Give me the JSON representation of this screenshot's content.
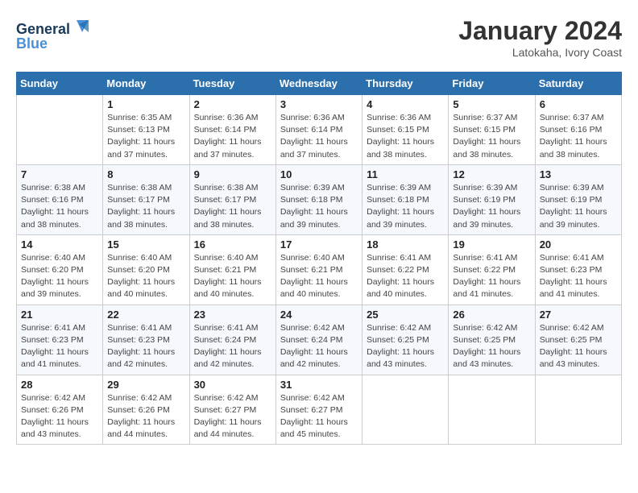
{
  "header": {
    "logo_line1": "General",
    "logo_line2": "Blue",
    "month_year": "January 2024",
    "location": "Latokaha, Ivory Coast"
  },
  "weekdays": [
    "Sunday",
    "Monday",
    "Tuesday",
    "Wednesday",
    "Thursday",
    "Friday",
    "Saturday"
  ],
  "weeks": [
    [
      {
        "day": "",
        "sunrise": "",
        "sunset": "",
        "daylight": ""
      },
      {
        "day": "1",
        "sunrise": "Sunrise: 6:35 AM",
        "sunset": "Sunset: 6:13 PM",
        "daylight": "Daylight: 11 hours and 37 minutes."
      },
      {
        "day": "2",
        "sunrise": "Sunrise: 6:36 AM",
        "sunset": "Sunset: 6:14 PM",
        "daylight": "Daylight: 11 hours and 37 minutes."
      },
      {
        "day": "3",
        "sunrise": "Sunrise: 6:36 AM",
        "sunset": "Sunset: 6:14 PM",
        "daylight": "Daylight: 11 hours and 37 minutes."
      },
      {
        "day": "4",
        "sunrise": "Sunrise: 6:36 AM",
        "sunset": "Sunset: 6:15 PM",
        "daylight": "Daylight: 11 hours and 38 minutes."
      },
      {
        "day": "5",
        "sunrise": "Sunrise: 6:37 AM",
        "sunset": "Sunset: 6:15 PM",
        "daylight": "Daylight: 11 hours and 38 minutes."
      },
      {
        "day": "6",
        "sunrise": "Sunrise: 6:37 AM",
        "sunset": "Sunset: 6:16 PM",
        "daylight": "Daylight: 11 hours and 38 minutes."
      }
    ],
    [
      {
        "day": "7",
        "sunrise": "Sunrise: 6:38 AM",
        "sunset": "Sunset: 6:16 PM",
        "daylight": "Daylight: 11 hours and 38 minutes."
      },
      {
        "day": "8",
        "sunrise": "Sunrise: 6:38 AM",
        "sunset": "Sunset: 6:17 PM",
        "daylight": "Daylight: 11 hours and 38 minutes."
      },
      {
        "day": "9",
        "sunrise": "Sunrise: 6:38 AM",
        "sunset": "Sunset: 6:17 PM",
        "daylight": "Daylight: 11 hours and 38 minutes."
      },
      {
        "day": "10",
        "sunrise": "Sunrise: 6:39 AM",
        "sunset": "Sunset: 6:18 PM",
        "daylight": "Daylight: 11 hours and 39 minutes."
      },
      {
        "day": "11",
        "sunrise": "Sunrise: 6:39 AM",
        "sunset": "Sunset: 6:18 PM",
        "daylight": "Daylight: 11 hours and 39 minutes."
      },
      {
        "day": "12",
        "sunrise": "Sunrise: 6:39 AM",
        "sunset": "Sunset: 6:19 PM",
        "daylight": "Daylight: 11 hours and 39 minutes."
      },
      {
        "day": "13",
        "sunrise": "Sunrise: 6:39 AM",
        "sunset": "Sunset: 6:19 PM",
        "daylight": "Daylight: 11 hours and 39 minutes."
      }
    ],
    [
      {
        "day": "14",
        "sunrise": "Sunrise: 6:40 AM",
        "sunset": "Sunset: 6:20 PM",
        "daylight": "Daylight: 11 hours and 39 minutes."
      },
      {
        "day": "15",
        "sunrise": "Sunrise: 6:40 AM",
        "sunset": "Sunset: 6:20 PM",
        "daylight": "Daylight: 11 hours and 40 minutes."
      },
      {
        "day": "16",
        "sunrise": "Sunrise: 6:40 AM",
        "sunset": "Sunset: 6:21 PM",
        "daylight": "Daylight: 11 hours and 40 minutes."
      },
      {
        "day": "17",
        "sunrise": "Sunrise: 6:40 AM",
        "sunset": "Sunset: 6:21 PM",
        "daylight": "Daylight: 11 hours and 40 minutes."
      },
      {
        "day": "18",
        "sunrise": "Sunrise: 6:41 AM",
        "sunset": "Sunset: 6:22 PM",
        "daylight": "Daylight: 11 hours and 40 minutes."
      },
      {
        "day": "19",
        "sunrise": "Sunrise: 6:41 AM",
        "sunset": "Sunset: 6:22 PM",
        "daylight": "Daylight: 11 hours and 41 minutes."
      },
      {
        "day": "20",
        "sunrise": "Sunrise: 6:41 AM",
        "sunset": "Sunset: 6:23 PM",
        "daylight": "Daylight: 11 hours and 41 minutes."
      }
    ],
    [
      {
        "day": "21",
        "sunrise": "Sunrise: 6:41 AM",
        "sunset": "Sunset: 6:23 PM",
        "daylight": "Daylight: 11 hours and 41 minutes."
      },
      {
        "day": "22",
        "sunrise": "Sunrise: 6:41 AM",
        "sunset": "Sunset: 6:23 PM",
        "daylight": "Daylight: 11 hours and 42 minutes."
      },
      {
        "day": "23",
        "sunrise": "Sunrise: 6:41 AM",
        "sunset": "Sunset: 6:24 PM",
        "daylight": "Daylight: 11 hours and 42 minutes."
      },
      {
        "day": "24",
        "sunrise": "Sunrise: 6:42 AM",
        "sunset": "Sunset: 6:24 PM",
        "daylight": "Daylight: 11 hours and 42 minutes."
      },
      {
        "day": "25",
        "sunrise": "Sunrise: 6:42 AM",
        "sunset": "Sunset: 6:25 PM",
        "daylight": "Daylight: 11 hours and 43 minutes."
      },
      {
        "day": "26",
        "sunrise": "Sunrise: 6:42 AM",
        "sunset": "Sunset: 6:25 PM",
        "daylight": "Daylight: 11 hours and 43 minutes."
      },
      {
        "day": "27",
        "sunrise": "Sunrise: 6:42 AM",
        "sunset": "Sunset: 6:25 PM",
        "daylight": "Daylight: 11 hours and 43 minutes."
      }
    ],
    [
      {
        "day": "28",
        "sunrise": "Sunrise: 6:42 AM",
        "sunset": "Sunset: 6:26 PM",
        "daylight": "Daylight: 11 hours and 43 minutes."
      },
      {
        "day": "29",
        "sunrise": "Sunrise: 6:42 AM",
        "sunset": "Sunset: 6:26 PM",
        "daylight": "Daylight: 11 hours and 44 minutes."
      },
      {
        "day": "30",
        "sunrise": "Sunrise: 6:42 AM",
        "sunset": "Sunset: 6:27 PM",
        "daylight": "Daylight: 11 hours and 44 minutes."
      },
      {
        "day": "31",
        "sunrise": "Sunrise: 6:42 AM",
        "sunset": "Sunset: 6:27 PM",
        "daylight": "Daylight: 11 hours and 45 minutes."
      },
      {
        "day": "",
        "sunrise": "",
        "sunset": "",
        "daylight": ""
      },
      {
        "day": "",
        "sunrise": "",
        "sunset": "",
        "daylight": ""
      },
      {
        "day": "",
        "sunrise": "",
        "sunset": "",
        "daylight": ""
      }
    ]
  ]
}
